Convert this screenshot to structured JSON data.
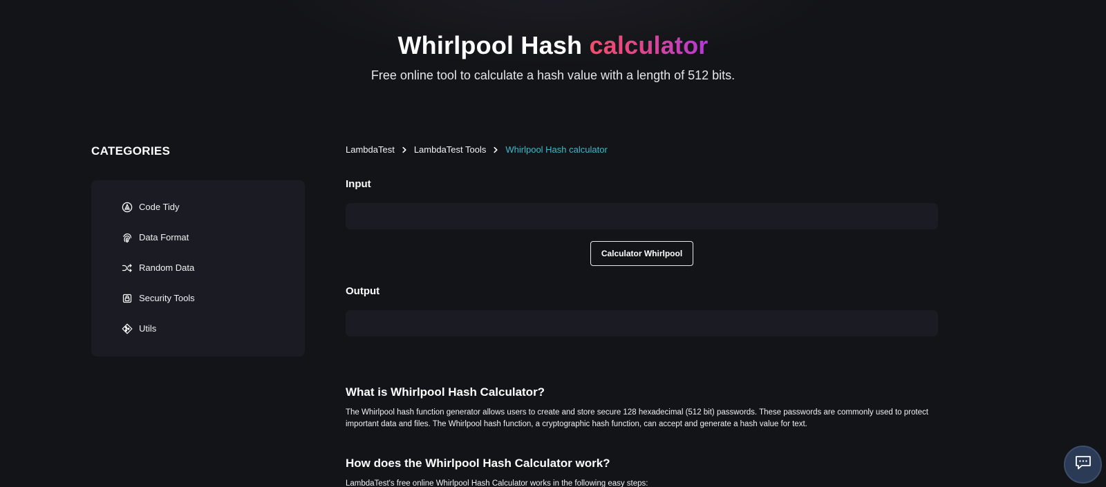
{
  "header": {
    "title_main": "Whirlpool Hash",
    "title_accent": "calculator",
    "subtitle": "Free online tool to calculate a hash value with a length of 512 bits."
  },
  "sidebar": {
    "heading": "CATEGORIES",
    "items": [
      {
        "label": "Code Tidy",
        "icon": "code-tidy-icon"
      },
      {
        "label": "Data Format",
        "icon": "fingerprint-icon"
      },
      {
        "label": "Random Data",
        "icon": "shuffle-icon"
      },
      {
        "label": "Security Tools",
        "icon": "lock-icon"
      },
      {
        "label": "Utils",
        "icon": "git-merge-icon"
      }
    ]
  },
  "breadcrumb": {
    "items": [
      "LambdaTest",
      "LambdaTest Tools"
    ],
    "current": "Whirlpool Hash calculator"
  },
  "tool": {
    "input_label": "Input",
    "input_value": "",
    "button_label": "Calculator Whirlpool",
    "output_label": "Output",
    "output_value": ""
  },
  "article": {
    "what_heading": "What is Whirlpool Hash Calculator?",
    "what_paragraph": "The Whirlpool hash function generator allows users to create and store secure 128 hexadecimal (512 bit) passwords. These passwords are commonly used to protect important data and files. The Whirlpool hash function, a cryptographic hash function, can accept and generate a hash value for text.",
    "how_heading": "How does the Whirlpool Hash Calculator work?",
    "how_paragraph": "LambdaTest's free online Whirlpool Hash Calculator works in the following easy steps:"
  },
  "chat": {
    "icon": "chat-icon"
  },
  "colors": {
    "background": "#131417",
    "panel": "#1b1c23",
    "accent_start": "#ef4f6a",
    "accent_end": "#b33ad8",
    "breadcrumb_current": "#3fb8d2"
  }
}
